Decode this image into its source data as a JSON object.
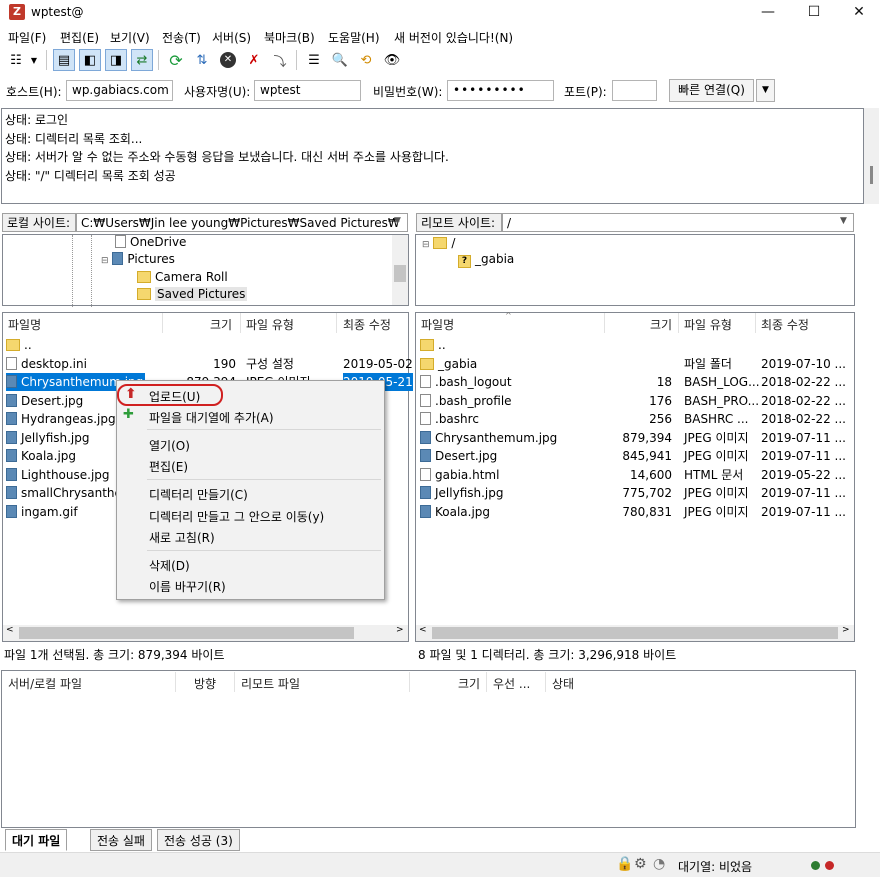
{
  "window": {
    "title": "wptest@",
    "minimize": "—",
    "maximize": "☐",
    "close": "✕"
  },
  "menu": [
    "파일(F)",
    "편집(E)",
    "보기(V)",
    "전송(T)",
    "서버(S)",
    "북마크(B)",
    "도움말(H)",
    "새 버전이 있습니다!(N)"
  ],
  "quickconnect": {
    "host_label": "호스트(H):",
    "host": "wp.gabiacs.com",
    "user_label": "사용자명(U):",
    "user": "wptest",
    "pass_label": "비밀번호(W):",
    "pass": "•••••••••",
    "port_label": "포트(P):",
    "port": "",
    "button": "빠른 연결(Q)",
    "dropdown": "▼"
  },
  "log": [
    {
      "label": "상태:",
      "text": "로그인"
    },
    {
      "label": "상태:",
      "text": "디렉터리 목록 조회..."
    },
    {
      "label": "상태:",
      "text": "서버가 알 수 없는 주소와 수동형 응답을 보냈습니다. 대신 서버 주소를 사용합니다."
    },
    {
      "label": "상태:",
      "text": "\"/\" 디렉터리 목록 조회 성공"
    }
  ],
  "local": {
    "site_label": "로컬 사이트:",
    "path": "C:₩Users₩Jin lee young₩Pictures₩Saved Pictures₩",
    "tree": [
      "OneDrive",
      "Pictures",
      "Camera Roll",
      "Saved Pictures"
    ],
    "headers": [
      "파일명",
      "크기",
      "파일 유형",
      "최종 수정"
    ],
    "files": [
      {
        "name": "..",
        "size": "",
        "type": "",
        "date": "",
        "icon": "folder"
      },
      {
        "name": "desktop.ini",
        "size": "190",
        "type": "구성 설정",
        "date": "2019-05-02",
        "icon": "file"
      },
      {
        "name": "Chrysanthemum.jpg",
        "size": "879,394",
        "type": "JPEG 이미지",
        "date": "2019-05-21",
        "icon": "image"
      },
      {
        "name": "Desert.jpg",
        "size": "",
        "type": "",
        "date": "5-21",
        "icon": "image"
      },
      {
        "name": "Hydrangeas.jpg",
        "size": "",
        "type": "",
        "date": "5-21",
        "icon": "image"
      },
      {
        "name": "Jellyfish.jpg",
        "size": "",
        "type": "",
        "date": "5-21",
        "icon": "image"
      },
      {
        "name": "Koala.jpg",
        "size": "",
        "type": "",
        "date": "5-21",
        "icon": "image"
      },
      {
        "name": "Lighthouse.jpg",
        "size": "",
        "type": "",
        "date": "5-21",
        "icon": "image"
      },
      {
        "name": "smallChrysanthem",
        "size": "",
        "type": "",
        "date": "5-21",
        "icon": "image"
      },
      {
        "name": "ingam.gif",
        "size": "",
        "type": "",
        "date": "5-13",
        "icon": "image"
      }
    ],
    "status": "파일 1개 선택됨. 총 크기: 879,394 바이트"
  },
  "remote": {
    "site_label": "리모트 사이트:",
    "path": "/",
    "tree": [
      "/",
      "_gabia"
    ],
    "headers": [
      "파일명",
      "크기",
      "파일 유형",
      "최종 수정"
    ],
    "files": [
      {
        "name": "..",
        "size": "",
        "type": "",
        "date": "",
        "icon": "folder"
      },
      {
        "name": "_gabia",
        "size": "",
        "type": "파일 폴더",
        "date": "2019-07-10 ...",
        "icon": "folder"
      },
      {
        "name": ".bash_logout",
        "size": "18",
        "type": "BASH_LOG...",
        "date": "2018-02-22 ...",
        "icon": "file"
      },
      {
        "name": ".bash_profile",
        "size": "176",
        "type": "BASH_PRO...",
        "date": "2018-02-22 ...",
        "icon": "file"
      },
      {
        "name": ".bashrc",
        "size": "256",
        "type": "BASHRC ...",
        "date": "2018-02-22 ...",
        "icon": "file"
      },
      {
        "name": "Chrysanthemum.jpg",
        "size": "879,394",
        "type": "JPEG 이미지",
        "date": "2019-07-11 ...",
        "icon": "image"
      },
      {
        "name": "Desert.jpg",
        "size": "845,941",
        "type": "JPEG 이미지",
        "date": "2019-07-11 ...",
        "icon": "image"
      },
      {
        "name": "gabia.html",
        "size": "14,600",
        "type": "HTML 문서",
        "date": "2019-05-22 ...",
        "icon": "file"
      },
      {
        "name": "Jellyfish.jpg",
        "size": "775,702",
        "type": "JPEG 이미지",
        "date": "2019-07-11 ...",
        "icon": "image"
      },
      {
        "name": "Koala.jpg",
        "size": "780,831",
        "type": "JPEG 이미지",
        "date": "2019-07-11 ...",
        "icon": "image"
      }
    ],
    "status": "8 파일 및 1 디렉터리. 총 크기: 3,296,918 바이트"
  },
  "context_menu": {
    "upload": "업로드(U)",
    "add_queue": "파일을 대기열에 추가(A)",
    "open": "열기(O)",
    "edit": "편집(E)",
    "mkdir": "디렉터리 만들기(C)",
    "mkdir_enter": "디렉터리 만들고 그 안으로 이동(y)",
    "refresh": "새로 고침(R)",
    "delete": "삭제(D)",
    "rename": "이름 바꾸기(R)"
  },
  "queue": {
    "headers": [
      "서버/로컬 파일",
      "방향",
      "리모트 파일",
      "크기",
      "우선 ...",
      "상태"
    ],
    "tabs": [
      "대기 파일",
      "전송 실패",
      "전송 성공 (3)"
    ]
  },
  "statusbar": {
    "queue_text": "대기열: 비었음"
  }
}
